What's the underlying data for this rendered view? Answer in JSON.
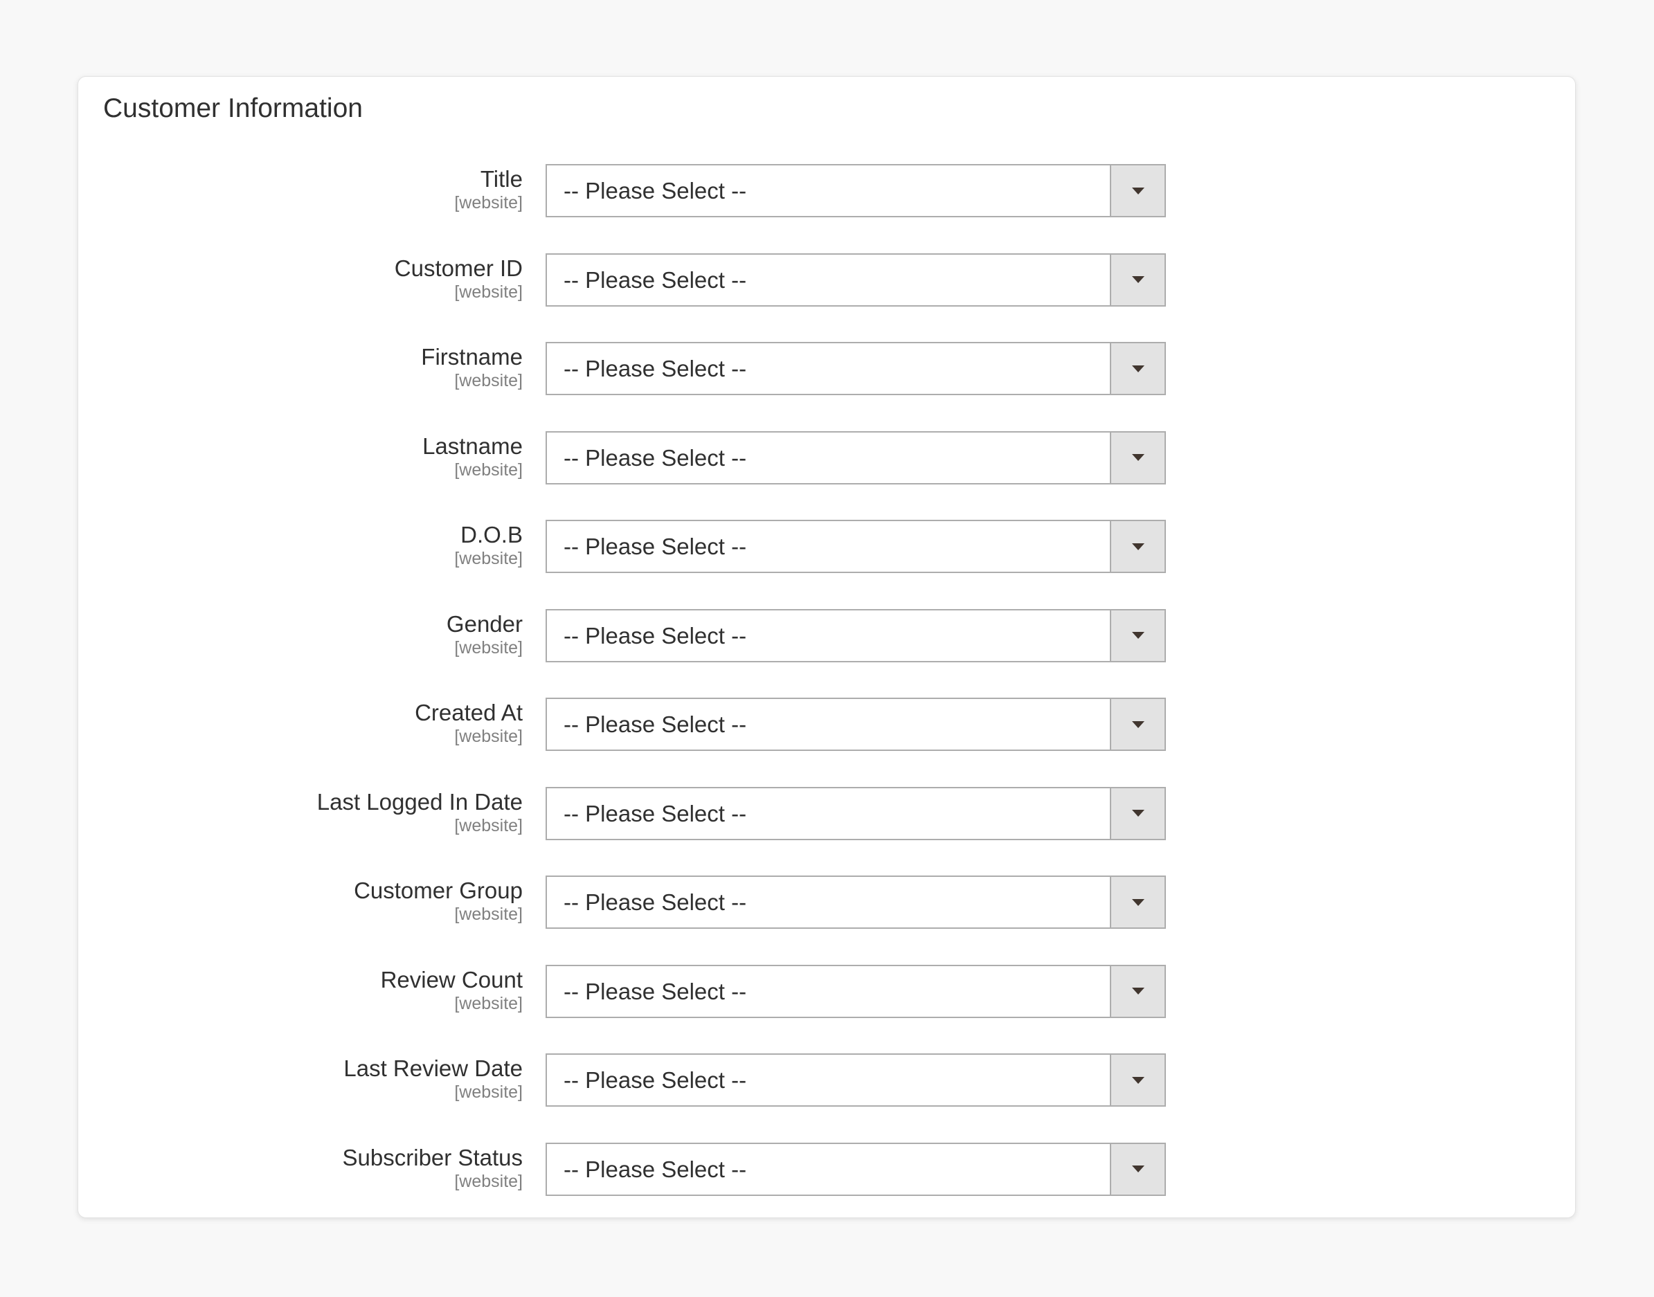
{
  "section": {
    "title": "Customer Information"
  },
  "fields": [
    {
      "label": "Title",
      "scope": "[website]",
      "value": "-- Please Select --"
    },
    {
      "label": "Customer ID",
      "scope": "[website]",
      "value": "-- Please Select --"
    },
    {
      "label": "Firstname",
      "scope": "[website]",
      "value": "-- Please Select --"
    },
    {
      "label": "Lastname",
      "scope": "[website]",
      "value": "-- Please Select --"
    },
    {
      "label": "D.O.B",
      "scope": "[website]",
      "value": "-- Please Select --"
    },
    {
      "label": "Gender",
      "scope": "[website]",
      "value": "-- Please Select --"
    },
    {
      "label": "Created At",
      "scope": "[website]",
      "value": "-- Please Select --"
    },
    {
      "label": "Last Logged In Date",
      "scope": "[website]",
      "value": "-- Please Select --"
    },
    {
      "label": "Customer Group",
      "scope": "[website]",
      "value": "-- Please Select --"
    },
    {
      "label": "Review Count",
      "scope": "[website]",
      "value": "-- Please Select --"
    },
    {
      "label": "Last Review Date",
      "scope": "[website]",
      "value": "-- Please Select --"
    },
    {
      "label": "Subscriber Status",
      "scope": "[website]",
      "value": "-- Please Select --"
    }
  ],
  "icons": {
    "dropdown": "chevron-down-icon"
  },
  "colors": {
    "page_background": "#f8f8f8",
    "panel_background": "#ffffff",
    "select_border": "#adadad",
    "select_button": "#e3e3e3",
    "arrow": "#41362f"
  }
}
